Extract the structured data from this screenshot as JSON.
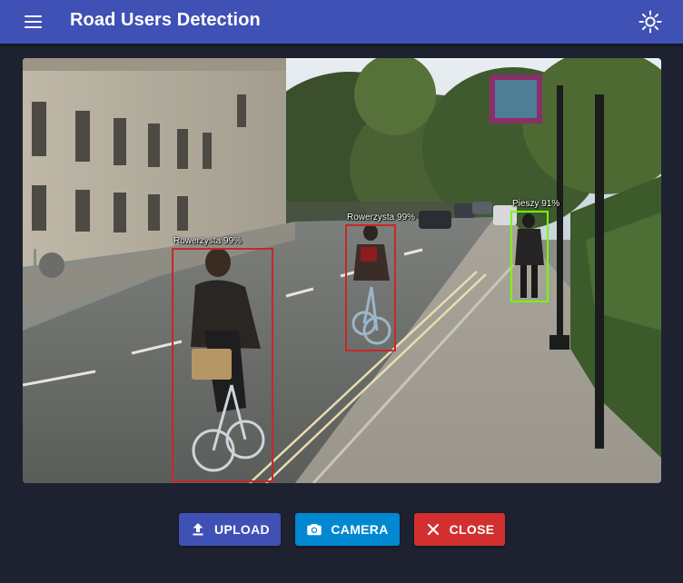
{
  "app": {
    "title": "Road Users Detection",
    "icons": {
      "menu": "menu-icon",
      "theme": "brightness-icon"
    },
    "colors": {
      "appbar": "#3f51b5",
      "background": "#1e2230"
    }
  },
  "detections": [
    {
      "label": "Rowerzysta 99%",
      "class": "Rowerzysta",
      "confidence": 0.99,
      "color": "#c62828"
    },
    {
      "label": "Rowerzysta 99%",
      "class": "Rowerzysta",
      "confidence": 0.99,
      "color": "#c62828"
    },
    {
      "label": "Pieszy 91%",
      "class": "Pieszy",
      "confidence": 0.91,
      "color": "#76ff03"
    }
  ],
  "actions": {
    "upload": {
      "label": "UPLOAD",
      "icon": "upload-icon",
      "color": "#3f51b5"
    },
    "camera": {
      "label": "CAMERA",
      "icon": "camera-icon",
      "color": "#0288d1"
    },
    "close": {
      "label": "CLOSE",
      "icon": "close-icon",
      "color": "#d32f2f"
    }
  }
}
